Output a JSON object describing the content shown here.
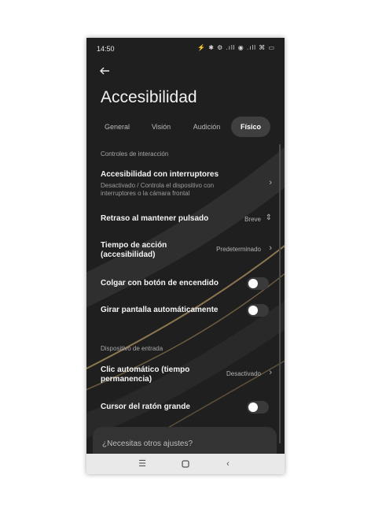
{
  "status": {
    "time": "14:50",
    "icons": "⚡ ✱ ⚙ .ıll ◉ .ıll ⌘ ▭"
  },
  "title": "Accesibilidad",
  "tabs": [
    {
      "label": "General",
      "active": false
    },
    {
      "label": "Visión",
      "active": false
    },
    {
      "label": "Audición",
      "active": false
    },
    {
      "label": "Físico",
      "active": true
    }
  ],
  "sections": {
    "interaction": "Controles de interacción",
    "input": "Dispositivo de entrada"
  },
  "rows": {
    "switch_access": {
      "label": "Accesibilidad con interruptores",
      "sub": "Desactivado / Controla el dispositivo con interruptores o la cámara frontal"
    },
    "hold_delay": {
      "label": "Retraso al mantener pulsado",
      "value": "Breve"
    },
    "action_time": {
      "label": "Tiempo de acción (accesibilidad)",
      "value": "Predeterminado"
    },
    "power_hangup": {
      "label": "Colgar con botón de encendido",
      "on": false
    },
    "auto_rotate": {
      "label": "Girar pantalla automáticamente",
      "on": false
    },
    "auto_click": {
      "label": "Clic automático (tiempo permanencia)",
      "value": "Desactivado"
    },
    "large_cursor": {
      "label": "Cursor del ratón grande",
      "on": false
    }
  },
  "card": {
    "text": "¿Necesitas otros ajustes?"
  },
  "icons": {
    "back": "arrow-left-icon",
    "chevron": "chevron-right-icon",
    "updown": "chevron-up-down-icon"
  }
}
